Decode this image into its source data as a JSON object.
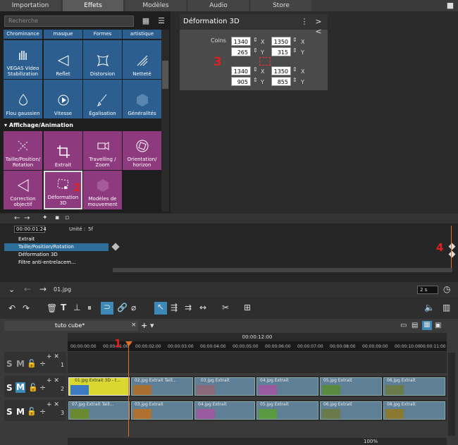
{
  "tabs": [
    "Importation",
    "Effets",
    "Modèles",
    "Audio",
    "Store"
  ],
  "active_tab": "Effets",
  "search": {
    "placeholder": "Recherche"
  },
  "effects_top_row": [
    "Chrominance",
    "masque",
    "Formes",
    "artistique"
  ],
  "effects_row1": [
    "VEGAS Video Stabilization",
    "Reflet",
    "Distorsion",
    "Netteté"
  ],
  "effects_row2": [
    "Flou gaussien",
    "Vitesse",
    "Égalisation",
    "Généralités"
  ],
  "section_title": "Affichage/Animation",
  "anim_row1": [
    "Taille/Position/ Rotation",
    "Extrait",
    "Travelling / Zoom",
    "Orientation/ horizon"
  ],
  "anim_row2": [
    "Correction objectif",
    "Déformation 3D",
    "Modèles de mouvement"
  ],
  "panel": {
    "title": "Déformation 3D",
    "coins_label": "Coins",
    "x_label": "X",
    "y_label": "Y",
    "values": {
      "tl_x": "1340",
      "tr_x": "1350",
      "tl_y": "265",
      "tr_y": "315",
      "bl_x": "1340",
      "br_x": "1350",
      "bl_y": "905",
      "br_y": "855"
    }
  },
  "keyframes": {
    "time": "00:00:01:24",
    "unit_label": "Unité :",
    "unit_value": "5f",
    "rows": [
      "Extrait",
      "Taille/Position/Rotation",
      "Déformation 3D",
      "Filtre anti-entrelacem..."
    ]
  },
  "nav": {
    "file": "01.jpg",
    "duration": "2 s"
  },
  "timeline": {
    "project_tab": "tuto cube*",
    "top_time": "00:00:12:00",
    "ruler": [
      "00:00:00:00",
      "00:00:01:00",
      "00:00:02:00",
      "00:00:03:00",
      "00:00:04:00",
      "00:00:05:00",
      "00:00:06:00",
      "00:00:07:00",
      "00:00:08:00",
      "00:00:09:00",
      "00:00:10:00",
      "00:00:11:00"
    ],
    "track_numbers": [
      "1",
      "2",
      "3"
    ],
    "track_letters": {
      "s": "S",
      "m": "M"
    },
    "track2_clips": [
      {
        "label": "01.jpg  Extrait  3D - t..."
      },
      {
        "label": "02.jpg  Extrait  Taill..."
      },
      {
        "label": "03.jpg  Extrait"
      },
      {
        "label": "04.jpg  Extrait"
      },
      {
        "label": "05.jpg  Extrait"
      },
      {
        "label": "06.jpg  Extrait"
      }
    ],
    "track3_clips": [
      {
        "label": "07.jpg  Extrait  Taill..."
      },
      {
        "label": "03.jpg  Extrait"
      },
      {
        "label": "04.jpg  Extrait"
      },
      {
        "label": "05.jpg  Extrait"
      },
      {
        "label": "06.jpg  Extrait"
      },
      {
        "label": "08.jpg  Extrait"
      }
    ],
    "zoom": "100%"
  },
  "annotations": [
    "1",
    "2",
    "3",
    "4"
  ],
  "colors": {
    "blue_tile": "#2c5f8f",
    "purple_tile": "#8e3a7e",
    "accent": "#e07020"
  }
}
